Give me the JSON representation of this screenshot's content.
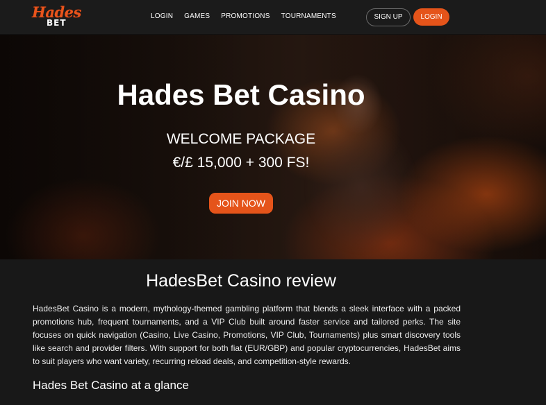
{
  "header": {
    "logo_top": "Hades",
    "logo_bottom": "BET",
    "nav": [
      "LOGIN",
      "GAMES",
      "PROMOTIONS",
      "TOURNAMENTS"
    ],
    "signup_label": "SIGN UP",
    "login_label": "LOGIN"
  },
  "hero": {
    "title": "Hades Bet Casino",
    "subtitle": "WELCOME PACKAGE",
    "offer": "€/£ 15,000 + 300 FS!",
    "cta_label": "JOIN NOW"
  },
  "content": {
    "review_title": "HadesBet Casino review",
    "review_body": "HadesBet Casino is a modern, mythology-themed gambling platform that blends a sleek interface with a packed promotions hub, frequent tournaments, and a VIP Club built around faster service and tailored perks. The site focuses on quick navigation (Casino, Live Casino, Promotions, VIP Club, Tournaments) plus smart discovery tools like search and provider filters. With support for both fiat (EUR/GBP) and popular cryptocurrencies, HadesBet aims to suit players who want variety, recurring reload deals, and competition-style rewards.",
    "glance_title": "Hades Bet Casino at a glance"
  },
  "colors": {
    "accent": "#e5541a",
    "background": "#181818",
    "header_bg": "#1b1b1b"
  }
}
